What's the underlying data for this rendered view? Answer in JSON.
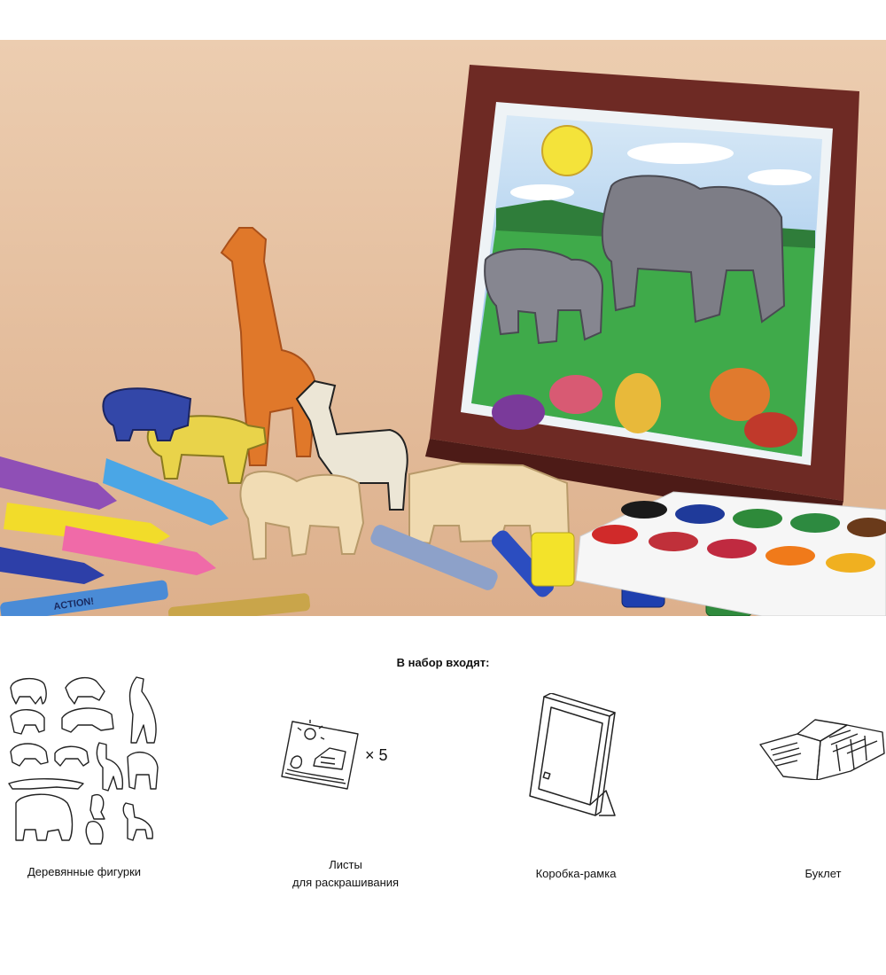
{
  "kit": {
    "title": "В набор входят:",
    "items": [
      {
        "icon": "wooden-figures-icon",
        "label": "Деревянные фигурки"
      },
      {
        "icon": "coloring-sheet-icon",
        "label_line1": "Листы",
        "label_line2": "для раскрашивания",
        "quantity": "× 5"
      },
      {
        "icon": "box-frame-icon",
        "label": "Коробка-рамка"
      },
      {
        "icon": "booklet-icon",
        "label": "Буклет"
      }
    ]
  },
  "photo": {
    "crayon_label": "ACTION!",
    "colors": {
      "background": "#e7c4a3",
      "frame": "#6e2a24",
      "giraffe": "#e0782a",
      "sky": "#7fb3e6",
      "grass": "#3faa4a"
    }
  }
}
